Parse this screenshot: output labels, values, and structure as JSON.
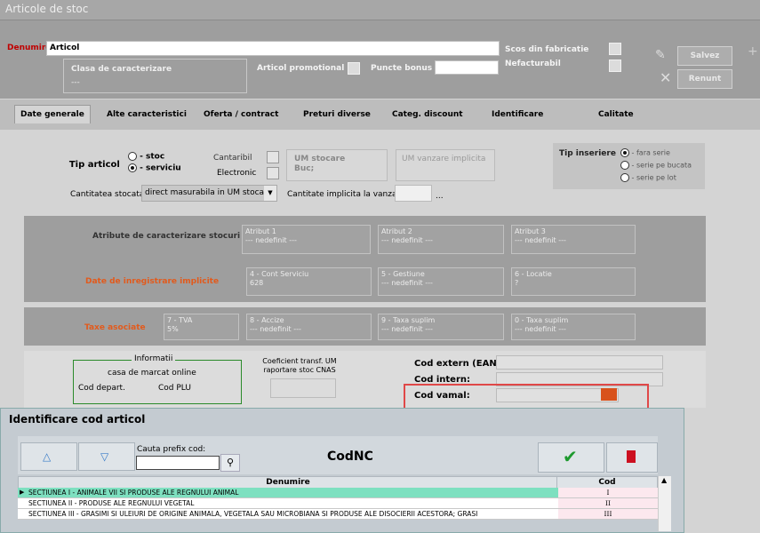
{
  "window": {
    "title": "Articole de stoc"
  },
  "header": {
    "denumire_label": "Denumire",
    "denumire_value": "Articol",
    "clasa_label": "Clasa de caracterizare",
    "clasa_value": "---",
    "promo_label": "Articol promotional",
    "puncte_label": "Puncte bonus",
    "scos_label": "Scos din fabricatie",
    "nefacturabil_label": "Nefacturabil",
    "save_label": "Salvez",
    "cancel_label": "Renunt"
  },
  "tabs": [
    {
      "label": "Date generale"
    },
    {
      "label": "Alte caracteristici"
    },
    {
      "label": "Oferta / contract"
    },
    {
      "label": "Preturi diverse"
    },
    {
      "label": "Categ. discount"
    },
    {
      "label": "Identificare"
    },
    {
      "label": "Calitate"
    }
  ],
  "general": {
    "tip_articol_label": "Tip articol",
    "stoc_label": "- stoc",
    "serviciu_label": "- serviciu",
    "cantaribil_label": "Cantaribil",
    "electronic_label": "Electronic",
    "um_stocare_label": "UM stocare",
    "um_stocare_value": "Buc;",
    "um_vanzare_label": "UM vanzare implicita",
    "tip_inserie_label": "Tip inseriere",
    "serie_opts": [
      "- fara serie",
      "- serie pe bucata",
      "- serie pe lot"
    ],
    "cantitatea_label": "Cantitatea stocata",
    "cantitatea_value": "direct masurabila in UM stocare",
    "cant_implicita_label": "Cantitate implicita la vanzare",
    "cant_implicita_value": "...",
    "atribute_label": "Atribute de caracterizare stocuri",
    "atribute": [
      {
        "label": "Atribut 1",
        "value": "--- nedefinit ---"
      },
      {
        "label": "Atribut 2",
        "value": "--- nedefinit ---"
      },
      {
        "label": "Atribut 3",
        "value": "--- nedefinit ---"
      }
    ],
    "date_inreg_label": "Date de inregistrare implicite",
    "date_inreg": [
      {
        "label": "4 - Cont Serviciu",
        "value": "628"
      },
      {
        "label": "5 - Gestiune",
        "value": "--- nedefinit ---"
      },
      {
        "label": "6 - Locatie",
        "value": "?"
      }
    ],
    "taxe_label": "Taxe asociate",
    "taxe": [
      {
        "label": "7 - TVA",
        "value": "5%"
      },
      {
        "label": "8 - Accize",
        "value": "--- nedefinit ---"
      },
      {
        "label": "9 - Taxa suplim",
        "value": "--- nedefinit ---"
      },
      {
        "label": "0 - Taxa suplim",
        "value": "--- nedefinit ---"
      }
    ],
    "informatii_label": "Informatii",
    "casa_label": "casa de marcat online",
    "cod_depart_label": "Cod depart.",
    "cod_plu_label": "Cod PLU",
    "coef_label": "Coeficient transf. UM raportare stoc CNAS",
    "cod_extern_label": "Cod extern (EAN):",
    "cod_intern_label": "Cod intern:",
    "cod_vamal_label": "Cod vamal:"
  },
  "dialog": {
    "title": "Identificare cod articol",
    "search_label": "Cauta prefix cod:",
    "search_value": "",
    "heading": "CodNC",
    "col_denumire": "Denumire",
    "col_cod": "Cod",
    "rows": [
      {
        "denumire": "SECTIUNEA I - ANIMALE VII SI PRODUSE ALE REGNULUI ANIMAL",
        "cod": "I"
      },
      {
        "denumire": "SECTIUNEA II - PRODUSE ALE REGNULUI VEGETAL",
        "cod": "II"
      },
      {
        "denumire": "SECTIUNEA III - GRASIMI SI ULEIURI DE ORIGINE ANIMALA, VEGETALA SAU MICROBIANA SI PRODUSE ALE DISOCIERII ACESTORA; GRASI",
        "cod": "III"
      }
    ]
  },
  "colors": {
    "accent_red": "#c00000",
    "orange": "#e25a1c",
    "selected_row": "#7ee0c0",
    "check_green": "#1e9a2e"
  }
}
